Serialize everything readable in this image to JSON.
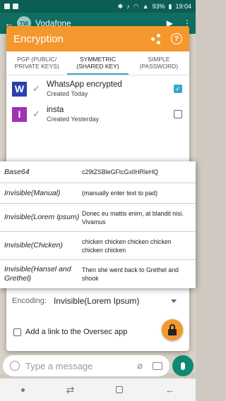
{
  "status_bar": {
    "battery": "93%",
    "time": "19:04"
  },
  "background_chat": {
    "contact_name": "Vodafone",
    "avatar_initials": "TW",
    "compose_placeholder": "Type a message"
  },
  "dialog": {
    "title": "Encryption",
    "tabs": [
      {
        "label": "PGP (PUBLIC/ PRIVATE KEYS)",
        "active": false
      },
      {
        "label": "SYMMETRIC (SHARED KEY)",
        "active": true
      },
      {
        "label": "SIMPLE (PASSWORD)",
        "active": false
      }
    ],
    "keys": [
      {
        "letter": "W",
        "color": "#2b3fb1",
        "name": "WhatsApp encrypted",
        "created": "Created Today",
        "selected": true
      },
      {
        "letter": "I",
        "color": "#9c33b7",
        "name": "insta",
        "created": "Created Yesterday",
        "selected": false
      }
    ],
    "encoding_label": "Encoding:",
    "encoding_value": "Invisible(Lorem Ipsum)",
    "link_option_label": "Add a link to the Oversec app"
  },
  "encoding_popup": {
    "options": [
      {
        "name": "Base64",
        "sample": "c29tZSBleGFtcGxlIHRleHQ"
      },
      {
        "name": "Invisible(Manual)",
        "sample": "(manually enter text to pad)"
      },
      {
        "name": "Invisible(Lorem Ipsum)",
        "sample": "Donec eu mattis enim, at blandit nisi. Vivamus"
      },
      {
        "name": "Invisible(Chicken)",
        "sample": "chicken chicken chicken chicken chicken chicken"
      },
      {
        "name": "Invisible(Hansel and Grethel)",
        "sample": "Then she went back to Grethel and shook"
      }
    ]
  },
  "colors": {
    "accent": "#f4982e",
    "tab_indicator": "#3aa7c6",
    "whatsapp_green": "#0f6e61"
  }
}
